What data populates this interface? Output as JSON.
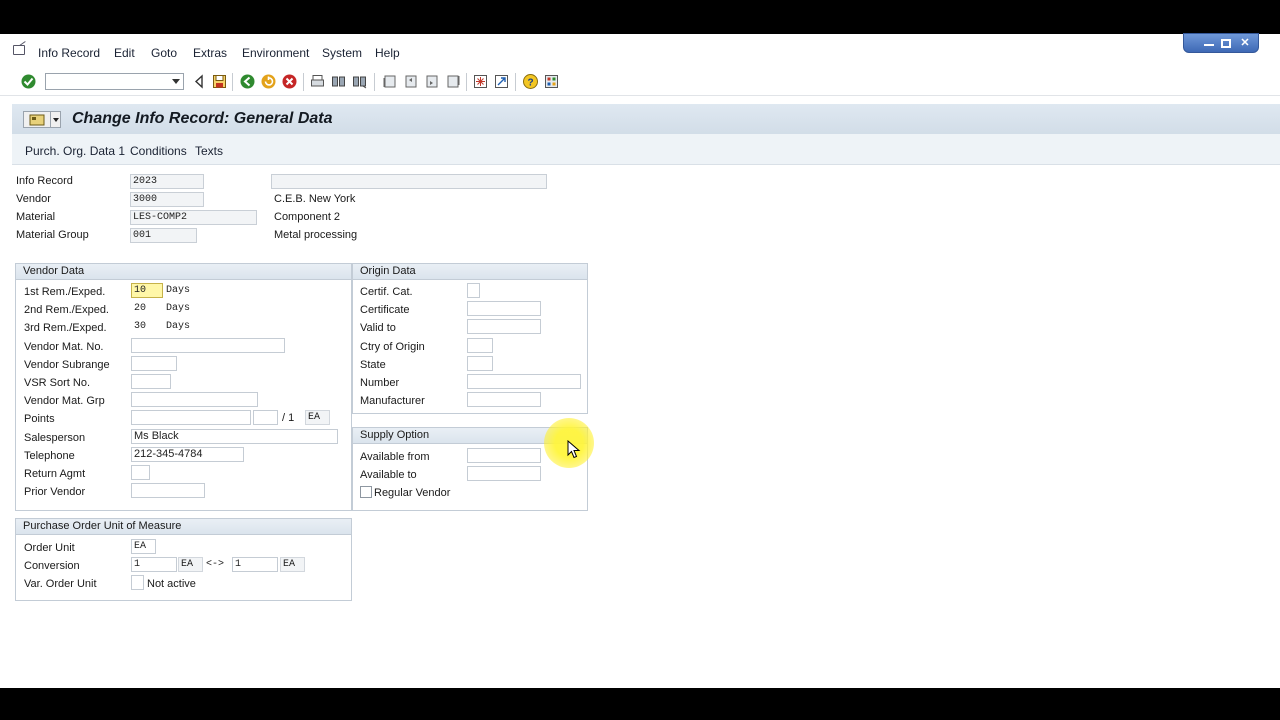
{
  "menubar": {
    "items": [
      {
        "label": "Info Record"
      },
      {
        "label": "Edit"
      },
      {
        "label": "Goto"
      },
      {
        "label": "Extras"
      },
      {
        "label": "Environment"
      },
      {
        "label": "System"
      },
      {
        "label": "Help"
      }
    ]
  },
  "window_controls": [
    "minimize-icon",
    "restore-icon",
    "close-icon"
  ],
  "toolbar": {
    "command_field_value": "",
    "icons": [
      "enter-icon",
      "back-icon",
      "save-icon",
      "green-back-icon",
      "exit-icon",
      "cancel-icon",
      "print-icon",
      "find-icon",
      "find-next-icon",
      "first-page-icon",
      "previous-page-icon",
      "next-page-icon",
      "last-page-icon",
      "create-session-icon",
      "shortcut-icon",
      "help-icon",
      "customize-layout-icon"
    ]
  },
  "title": "Change Info Record: General Data",
  "app_toolbar": {
    "buttons": [
      {
        "label": "Purch. Org. Data 1"
      },
      {
        "label": "Conditions"
      },
      {
        "label": "Texts"
      }
    ]
  },
  "header": {
    "info_record": {
      "label": "Info Record",
      "value": "2023"
    },
    "vendor": {
      "label": "Vendor",
      "value": "3000",
      "description": "C.E.B. New York"
    },
    "material": {
      "label": "Material",
      "value": "LES-COMP2",
      "description": "Component 2"
    },
    "material_group": {
      "label": "Material Group",
      "value": "001",
      "description": "Metal processing"
    },
    "long_field_value": ""
  },
  "vendor_data": {
    "title": "Vendor Data",
    "rem1": {
      "label": "1st Rem./Exped.",
      "value": "10",
      "unit": "Days"
    },
    "rem2": {
      "label": "2nd Rem./Exped.",
      "value": "20",
      "unit": "Days"
    },
    "rem3": {
      "label": "3rd Rem./Exped.",
      "value": "30",
      "unit": "Days"
    },
    "vendor_mat_no": {
      "label": "Vendor Mat. No.",
      "value": ""
    },
    "vendor_subrange": {
      "label": "Vendor Subrange",
      "value": ""
    },
    "vsr_sort_no": {
      "label": "VSR Sort No.",
      "value": ""
    },
    "vendor_mat_grp": {
      "label": "Vendor Mat. Grp",
      "value": ""
    },
    "points": {
      "label": "Points",
      "value": "",
      "value2": "",
      "sep": "/ 1",
      "unit": "EA"
    },
    "salesperson": {
      "label": "Salesperson",
      "value": "Ms Black"
    },
    "telephone": {
      "label": "Telephone",
      "value": "212-345-4784"
    },
    "return_agmt": {
      "label": "Return Agmt",
      "value": ""
    },
    "prior_vendor": {
      "label": "Prior Vendor",
      "value": ""
    }
  },
  "origin_data": {
    "title": "Origin Data",
    "certif_cat": {
      "label": "Certif. Cat.",
      "value": ""
    },
    "certificate": {
      "label": "Certificate",
      "value": ""
    },
    "valid_to": {
      "label": "Valid to",
      "value": ""
    },
    "ctry_of_origin": {
      "label": "Ctry of Origin",
      "value": ""
    },
    "state": {
      "label": "State",
      "value": ""
    },
    "number": {
      "label": "Number",
      "value": ""
    },
    "manufacturer": {
      "label": "Manufacturer",
      "value": ""
    }
  },
  "supply_option": {
    "title": "Supply Option",
    "available_from": {
      "label": "Available from",
      "value": ""
    },
    "available_to": {
      "label": "Available to",
      "value": ""
    },
    "regular_vendor": {
      "label": "Regular Vendor",
      "checked": false
    }
  },
  "po_unit": {
    "title": "Purchase Order Unit of Measure",
    "order_unit": {
      "label": "Order Unit",
      "value": "EA"
    },
    "conversion": {
      "label": "Conversion",
      "value1": "1",
      "unit1": "EA",
      "arrow": "<->",
      "value2": "1",
      "unit2": "EA"
    },
    "var_order_unit": {
      "label": "Var. Order Unit",
      "status": "Not active"
    }
  },
  "colors": {
    "title_bar": "#d7e1eb",
    "active_field": "#fff7a8",
    "cursor_highlight": "#fff53c"
  }
}
